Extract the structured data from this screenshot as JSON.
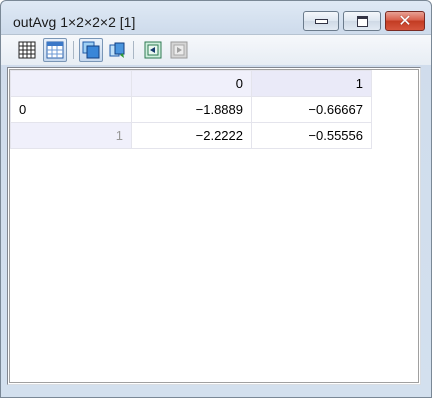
{
  "window": {
    "title": "outAvg 1×2×2×2 [1]"
  },
  "toolbar": {
    "buttons": [
      {
        "icon": "grid-icon"
      },
      {
        "icon": "table-view-icon"
      },
      {
        "icon": "copy-icon"
      },
      {
        "icon": "refresh-icon"
      },
      {
        "icon": "previous-icon"
      },
      {
        "icon": "next-icon"
      }
    ]
  },
  "table": {
    "column_headers": [
      "0",
      "1"
    ],
    "rows": [
      {
        "header": "0",
        "values": [
          "−1.8889",
          "−0.66667"
        ]
      },
      {
        "header": "1",
        "values": [
          "−2.2222",
          "−0.55556"
        ]
      }
    ]
  },
  "colors": {
    "header_bg": "#f0f0fb",
    "close_button": "#c23c23"
  }
}
